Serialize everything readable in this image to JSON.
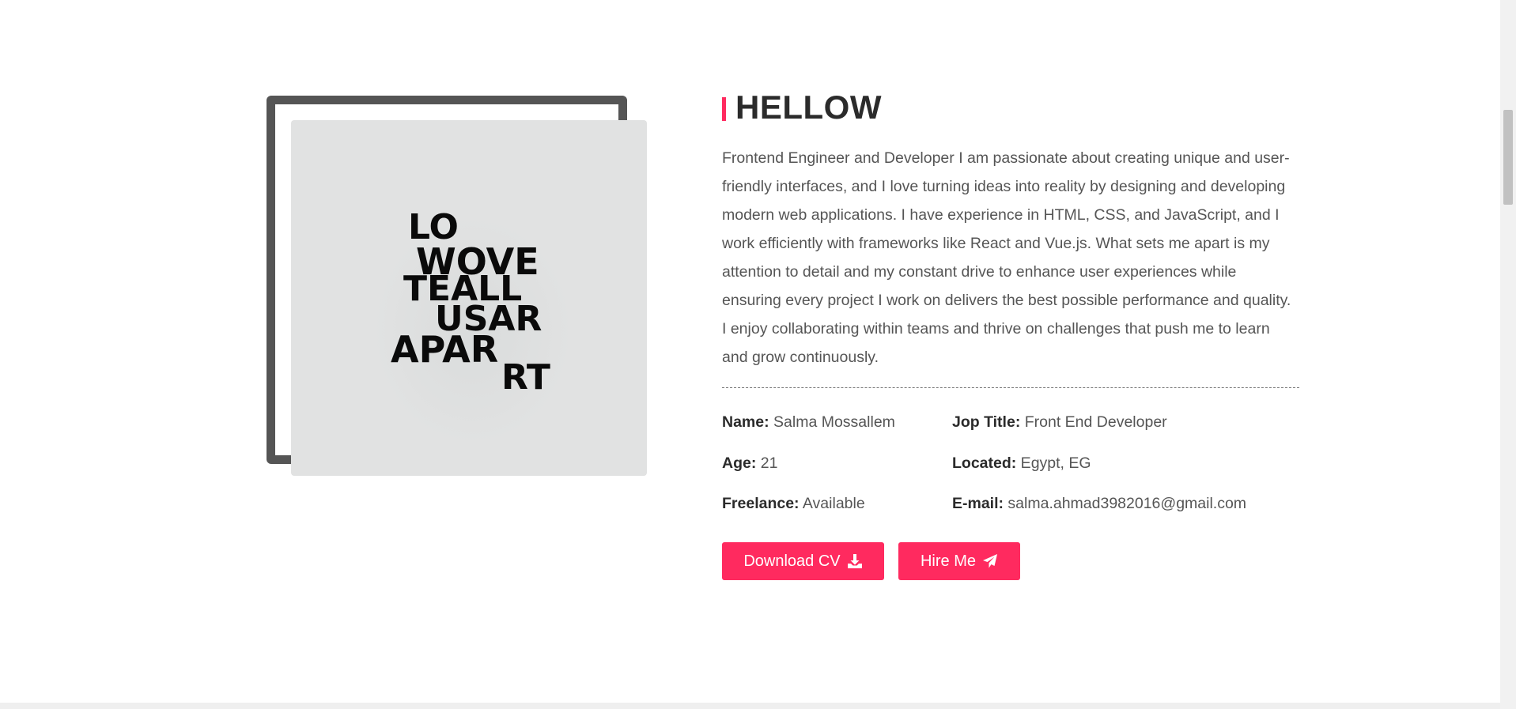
{
  "about": {
    "heading": "HELLOW",
    "bio": "Frontend Engineer and Developer I am passionate about creating unique and user-friendly interfaces, and I love turning ideas into reality by designing and developing modern web applications. I have experience in HTML, CSS, and JavaScript, and I work efficiently with frameworks like React and Vue.js. What sets me apart is my attention to detail and my constant drive to enhance user experiences while ensuring every project I work on delivers the best possible performance and quality. I enjoy collaborating within teams and thrive on challenges that push me to learn and grow continuously.",
    "info": {
      "name_label": "Name:",
      "name_value": " Salma Mossallem",
      "job_label": "Jop Title:",
      "job_value": " Front End Developer",
      "age_label": "Age:",
      "age_value": " 21",
      "located_label": "Located:",
      "located_value": " Egypt, EG",
      "freelance_label": "Freelance:",
      "freelance_value": " Available",
      "email_label": "E-mail:",
      "email_value": " salma.ahmad3982016@gmail.com"
    },
    "buttons": {
      "download_label": "Download CV",
      "hire_label": "Hire Me"
    }
  },
  "photo": {
    "artwork_text": [
      "LO",
      "WOVE",
      "TEALL",
      "USAR",
      "APAR",
      "RT"
    ]
  },
  "icons": {
    "download": "download-icon",
    "hire": "paper-plane-icon"
  },
  "colors": {
    "accent": "#ff2a5f",
    "frame": "#555555",
    "heading": "#2b2b2b",
    "text": "#555555",
    "photo_bg": "#e1e2e2"
  }
}
